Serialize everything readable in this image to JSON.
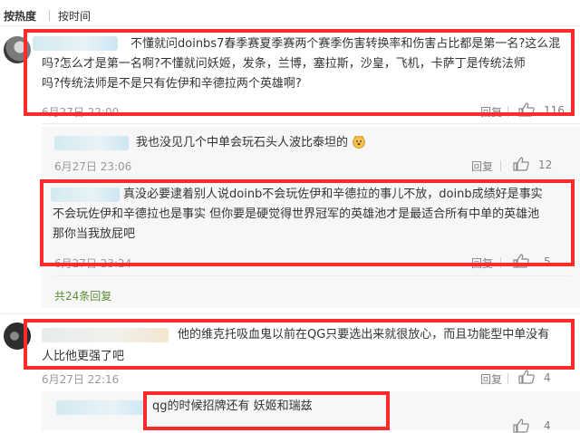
{
  "sort": {
    "hot": "按热度",
    "time": "按时间"
  },
  "comments": [
    {
      "text_lines": [
        "不懂就问doinbs7春季赛夏季赛两个赛季伤害转换率和伤害占比都是第一名?这么混",
        "吗?怎么才是第一名啊?不懂就问妖姬，发条，兰博，塞拉斯，沙皇，飞机，卡萨丁是传统法师",
        "吗?传统法师是不是只有佐伊和辛德拉两个英雄啊?"
      ],
      "time": "6月27日 22:00",
      "reply_label": "回复",
      "likes": "116"
    },
    {
      "text": "我也没见几个中单会玩石头人波比泰坦的",
      "emoji": "doge-emoji",
      "time": "6月27日 23:06",
      "reply_label": "回复",
      "likes": "12"
    },
    {
      "text_lines": [
        "真没必要逮着别人说doinb不会玩佐伊和辛德拉的事儿不放，doinb成绩好是事实",
        "不会玩佐伊和辛德拉也是事实 但你要是硬觉得世界冠军的英雄池才是最适合所有中单的英雄池",
        "那你当我放屁吧"
      ],
      "time": "6月27日 23:24",
      "reply_label": "回复",
      "likes": "5"
    },
    {
      "more_replies": "共24条回复"
    },
    {
      "text_lines": [
        "他的维克托吸血鬼以前在QG只要选出来就很放心，而且功能型中单没有",
        "人比他更强了吧"
      ],
      "time": "6月27日 22:16",
      "reply_label": "回复",
      "likes": "4"
    },
    {
      "text": "qg的时候招牌还有  妖姬和瑞兹",
      "likes": "4"
    }
  ],
  "colors": {
    "highlight_border": "#ff2b2b",
    "more_link": "#5a8d35",
    "meta_text": "#999999"
  }
}
